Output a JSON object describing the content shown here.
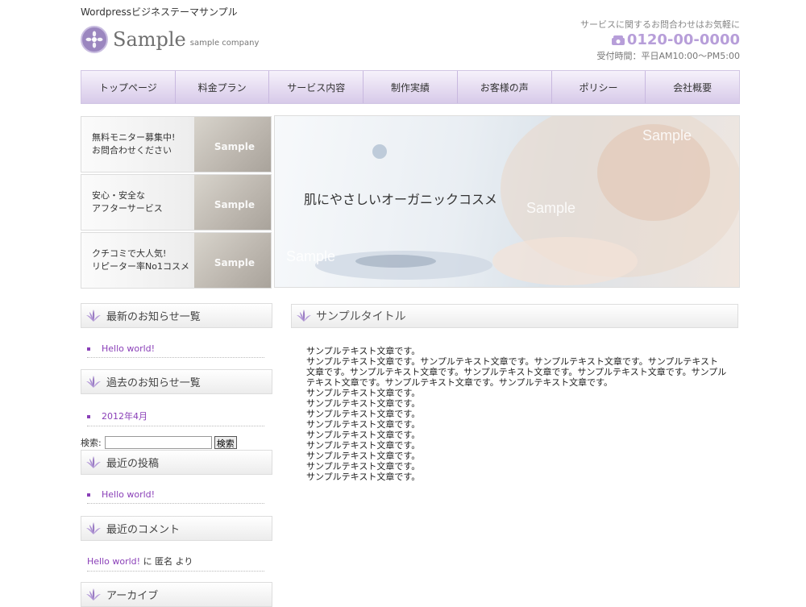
{
  "header": {
    "tagline": "Wordpressビジネステーマサンプル",
    "logo_name": "Sample",
    "logo_sub": "sample company",
    "contact_note": "サービスに関するお問合わせはお気軽に",
    "phone": "0120-00-0000",
    "hours": "受付時間：平日AM10:00〜PM5:00"
  },
  "nav": [
    "トップページ",
    "料金プラン",
    "サービス内容",
    "制作実績",
    "お客様の声",
    "ポリシー",
    "会社概要"
  ],
  "banners": [
    {
      "line1": "無料モニター募集中!",
      "line2": "お問合わせください",
      "watermark": "Sample"
    },
    {
      "line1": "安心・安全な",
      "line2": "アフターサービス",
      "watermark": "Sample"
    },
    {
      "line1": "クチコミで大人気!",
      "line2": "リピーター率No1コスメ",
      "watermark": "Sample"
    }
  ],
  "hero": {
    "caption": "肌にやさしいオーガニックコスメ",
    "watermark": "Sample"
  },
  "sidebar": {
    "news_title": "最新のお知らせ一覧",
    "news_link": "Hello world!",
    "past_title": "過去のお知らせ一覧",
    "past_link": "2012年4月",
    "search_label": "検索:",
    "search_value": "",
    "search_button": "検索",
    "recent_title": "最近の投稿",
    "recent_link": "Hello world!",
    "comments_title": "最近のコメント",
    "comment_link": "Hello world!",
    "comment_mid": "に",
    "comment_author": "匿名",
    "comment_end": "より",
    "archive_title": "アーカイブ"
  },
  "main": {
    "title": "サンプルタイトル",
    "paragraphs": [
      "サンプルテキスト文章です。",
      "サンプルテキスト文章です。サンプルテキスト文章です。サンプルテキスト文章です。サンプルテキスト文章です。サンプルテキスト文章です。サンプルテキスト文章です。サンプルテキスト文章です。サンプルテキスト文章です。サンプルテキスト文章です。サンプルテキスト文章です。",
      "サンプルテキスト文章です。",
      "サンプルテキスト文章です。",
      "サンプルテキスト文章です。",
      "サンプルテキスト文章です。",
      "サンプルテキスト文章です。",
      "サンプルテキスト文章です。",
      "サンプルテキスト文章です。",
      "サンプルテキスト文章です。",
      "サンプルテキスト文章です。"
    ]
  },
  "colors": {
    "accent": "#b79ed9",
    "link": "#8a3fb8",
    "nav_border": "#c8b8df"
  }
}
